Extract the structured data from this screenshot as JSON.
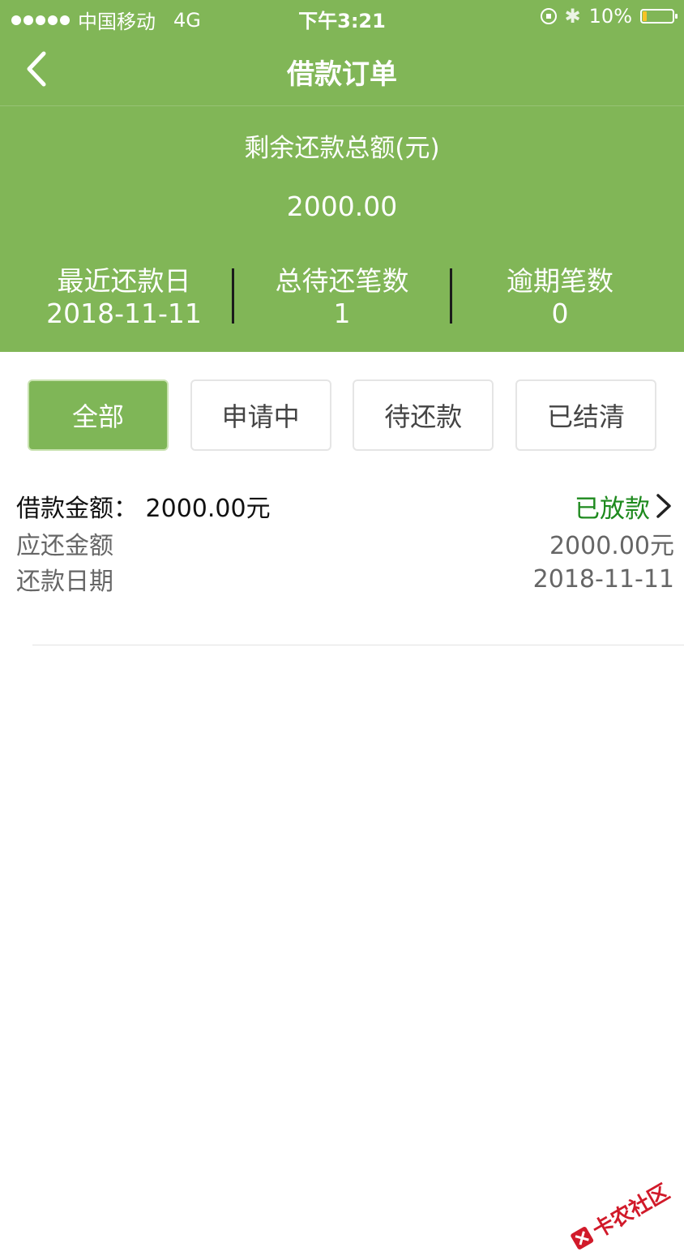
{
  "status_bar": {
    "carrier": "中国移动",
    "network": "4G",
    "time": "下午3:21",
    "battery": "10%"
  },
  "nav": {
    "title": "借款订单"
  },
  "summary": {
    "label": "剩余还款总额(元)",
    "amount": "2000.00",
    "stats": [
      {
        "label": "最近还款日",
        "value": "2018-11-11"
      },
      {
        "label": "总待还笔数",
        "value": "1"
      },
      {
        "label": "逾期笔数",
        "value": "0"
      }
    ]
  },
  "tabs": [
    {
      "label": "全部",
      "active": true
    },
    {
      "label": "申请中",
      "active": false
    },
    {
      "label": "待还款",
      "active": false
    },
    {
      "label": "已结清",
      "active": false
    }
  ],
  "order": {
    "amount_label": "借款金额：",
    "amount_value": "2000.00元",
    "status": "已放款",
    "rows": [
      {
        "label": "应还金额",
        "value": "2000.00元"
      },
      {
        "label": "还款日期",
        "value": "2018-11-11"
      }
    ]
  },
  "watermark": {
    "text": "卡农社区"
  },
  "colors": {
    "theme_green": "#81b657",
    "status_green": "#1e8a1e",
    "watermark_red": "#d11a2a"
  },
  "icons": {
    "back": "chevron-left-icon",
    "status_arrow": "chevron-right-icon"
  }
}
